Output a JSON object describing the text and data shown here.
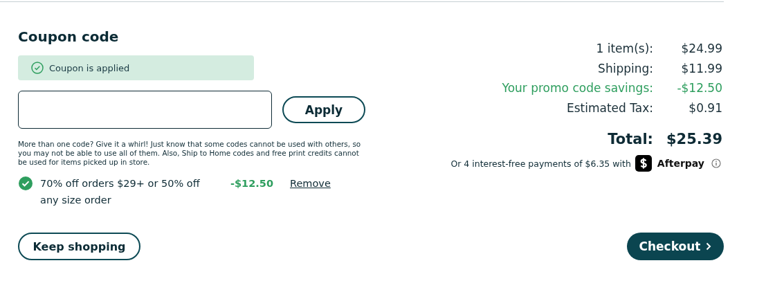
{
  "coupon": {
    "title": "Coupon code",
    "status": "Coupon is applied",
    "apply_button": "Apply",
    "note": "More than one code? Give it a whirl! Just know that some codes cannot be used with others, so you may not be able to use all of them. Also, Ship to Home codes and free print credits cannot be used for items picked up in store.",
    "applied": [
      {
        "description": "70% off orders $29+ or 50% off any size order",
        "amount": "-$12.50",
        "remove": "Remove"
      }
    ]
  },
  "summary": {
    "rows": [
      {
        "label": "1 item(s):",
        "value": "$24.99",
        "kind": "normal"
      },
      {
        "label": "Shipping:",
        "value": "$11.99",
        "kind": "normal"
      },
      {
        "label": "Your promo code savings:",
        "value": "-$12.50",
        "kind": "savings"
      },
      {
        "label": "Estimated Tax:",
        "value": "$0.91",
        "kind": "normal"
      }
    ],
    "total": {
      "label": "Total:",
      "value": "$25.39"
    },
    "afterpay": {
      "text": "Or 4 interest-free payments of $6.35 with",
      "brand": "Afterpay"
    }
  },
  "buttons": {
    "keep_shopping": "Keep shopping",
    "checkout": "Checkout"
  }
}
